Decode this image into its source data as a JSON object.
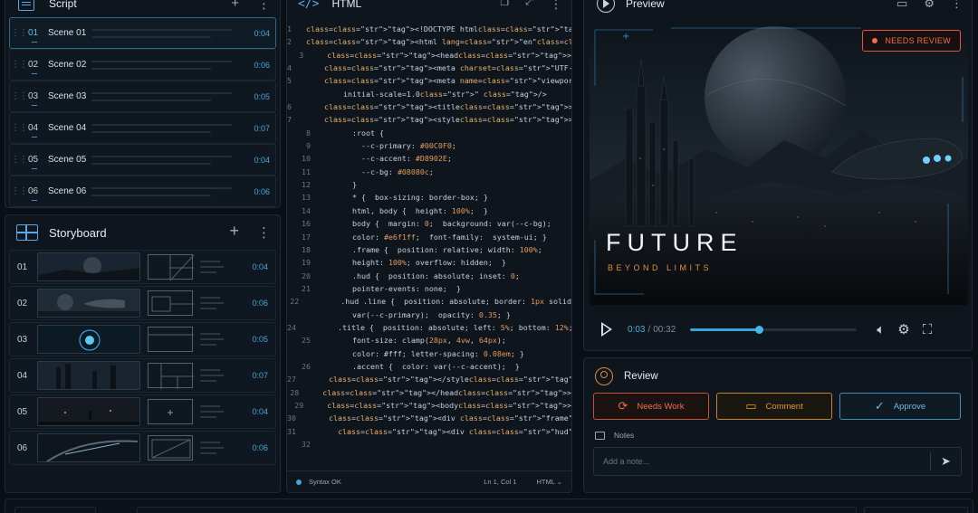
{
  "script": {
    "title": "Script",
    "scenes": [
      {
        "num": "01",
        "name": "Scene 01",
        "duration": "0:04",
        "selected": true
      },
      {
        "num": "02",
        "name": "Scene 02",
        "duration": "0:06"
      },
      {
        "num": "03",
        "name": "Scene 03",
        "duration": "0:05"
      },
      {
        "num": "04",
        "name": "Scene 04",
        "duration": "0:07"
      },
      {
        "num": "05",
        "name": "Scene 05",
        "duration": "0:04"
      },
      {
        "num": "06",
        "name": "Scene 06",
        "duration": "0:06"
      }
    ]
  },
  "storyboard": {
    "title": "Storyboard",
    "frames": [
      {
        "num": "01",
        "duration": "0:04"
      },
      {
        "num": "02",
        "duration": "0:06"
      },
      {
        "num": "03",
        "duration": "0:05"
      },
      {
        "num": "04",
        "duration": "0:07"
      },
      {
        "num": "05",
        "duration": "0:04"
      },
      {
        "num": "06",
        "duration": "0:06"
      }
    ]
  },
  "editor": {
    "title": "HTML",
    "status": "Syntax OK",
    "cursor": "Ln 1, Col 1",
    "language": "HTML",
    "lines": [
      {
        "n": "1",
        "t": "<!DOCTYPE html>"
      },
      {
        "n": "2",
        "t": "<html lang=\"en\">"
      },
      {
        "n": "3",
        "t": "  <head>"
      },
      {
        "n": "4",
        "t": "    <meta charset=\"UTF-8\" />"
      },
      {
        "n": "5",
        "t": "    <meta name=\"viewport\" content=\"width=device-width,"
      },
      {
        "n": "",
        "t": "    initial-scale=1.0\" />"
      },
      {
        "n": "6",
        "t": "    <title>Video</title>"
      },
      {
        "n": "7",
        "t": "    <style>"
      },
      {
        "n": "8",
        "t": "      :root {"
      },
      {
        "n": "9",
        "t": "        --c-primary: #00C0F0;"
      },
      {
        "n": "10",
        "t": "        --c-accent: #D8902E;"
      },
      {
        "n": "11",
        "t": "        --c-bg: #08080c;"
      },
      {
        "n": "12",
        "t": "      }"
      },
      {
        "n": "13",
        "t": "      * {  box-sizing: border-box; }"
      },
      {
        "n": "14",
        "t": "      html, body {  height: 100%;  }"
      },
      {
        "n": "16",
        "t": "      body {  margin: 0;  background: var(--c-bg);"
      },
      {
        "n": "17",
        "t": "      color: #e6f1ff;  font-family:  system-ui; }"
      },
      {
        "n": "18",
        "t": "      .frame {  position: relative; width: 100%;"
      },
      {
        "n": "19",
        "t": "      height: 100%; overflow: hidden;  }"
      },
      {
        "n": "20",
        "t": "      .hud {  position: absolute; inset: 0;"
      },
      {
        "n": "21",
        "t": "      pointer-events: none;  }"
      },
      {
        "n": "22",
        "t": "      .hud .line {  position: absolute; border: 1px solid"
      },
      {
        "n": "",
        "t": "      var(--c-primary);  opacity: 0.35; }"
      },
      {
        "n": "24",
        "t": "      .title {  position: absolute; left: 5%; bottom: 12%;"
      },
      {
        "n": "25",
        "t": "      font-size: clamp(28px, 4vw, 64px);"
      },
      {
        "n": "",
        "t": "      color: #fff; letter-spacing: 0.08em; }"
      },
      {
        "n": "26",
        "t": "      .accent {  color: var(--c-accent);  }"
      },
      {
        "n": "27",
        "t": "    </style>"
      },
      {
        "n": "28",
        "t": "  </head>"
      },
      {
        "n": "29",
        "t": "  <body>"
      },
      {
        "n": "30",
        "t": "    <div class=\"frame\">"
      },
      {
        "n": "31",
        "t": "      <div class=\"hud\">"
      },
      {
        "n": "32",
        "t": ""
      }
    ]
  },
  "preview": {
    "title": "Preview",
    "badge": "NEEDS REVIEW",
    "video_title": "FUTURE",
    "video_subtitle": "BEYOND LIMITS",
    "time_current": "0:03",
    "time_total": "00:32",
    "progress": 0.41
  },
  "review": {
    "title": "Review",
    "buttons": {
      "needs_work": "Needs Work",
      "comment": "Comment",
      "approve": "Approve"
    },
    "notes_label": "Notes",
    "note_placeholder": "Add a note..."
  },
  "colors": {
    "accent_blue": "#2fa8de",
    "accent_orange": "#e0913e",
    "alert_red": "#e0573a"
  }
}
